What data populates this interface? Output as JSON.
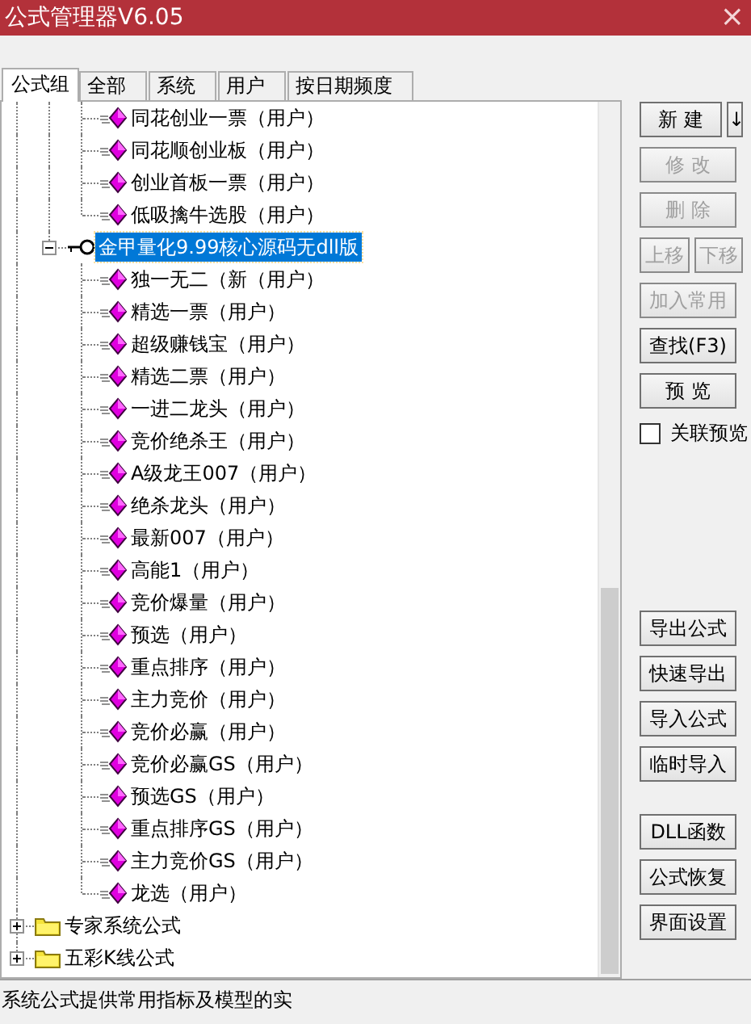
{
  "window": {
    "title": "公式管理器V6.05",
    "close": "×"
  },
  "tabs": [
    {
      "label": "公式组",
      "selected": true
    },
    {
      "label": "全部",
      "selected": false
    },
    {
      "label": "系统",
      "selected": false
    },
    {
      "label": "用户",
      "selected": false
    },
    {
      "label": "按日期频度",
      "selected": false
    }
  ],
  "tree": [
    {
      "children": [
        {
          "children": [
            {
              "kind": "formula",
              "label": "同花创业一票（用户）"
            },
            {
              "kind": "formula",
              "label": "同花顺创业板（用户）"
            },
            {
              "kind": "formula",
              "label": "创业首板一票（用户）"
            },
            {
              "kind": "formula",
              "label": "低吸擒牛选股（用户）"
            }
          ]
        },
        {
          "kind": "group",
          "label": "金甲量化9.99核心源码无dll版",
          "expanded": true,
          "selected": true,
          "children": [
            {
              "kind": "formula",
              "label": "独一无二（新（用户）"
            },
            {
              "kind": "formula",
              "label": "精选一票（用户）"
            },
            {
              "kind": "formula",
              "label": "超级赚钱宝（用户）"
            },
            {
              "kind": "formula",
              "label": "精选二票（用户）"
            },
            {
              "kind": "formula",
              "label": "一进二龙头（用户）"
            },
            {
              "kind": "formula",
              "label": "竞价绝杀王（用户）"
            },
            {
              "kind": "formula",
              "label": "A级龙王007（用户）"
            },
            {
              "kind": "formula",
              "label": "绝杀龙头（用户）"
            },
            {
              "kind": "formula",
              "label": "最新007（用户）"
            },
            {
              "kind": "formula",
              "label": "高能1（用户）"
            },
            {
              "kind": "formula",
              "label": "竞价爆量（用户）"
            },
            {
              "kind": "formula",
              "label": "预选（用户）"
            },
            {
              "kind": "formula",
              "label": "重点排序（用户）"
            },
            {
              "kind": "formula",
              "label": "主力竞价（用户）"
            },
            {
              "kind": "formula",
              "label": "竞价必赢（用户）"
            },
            {
              "kind": "formula",
              "label": "竞价必赢GS（用户）"
            },
            {
              "kind": "formula",
              "label": "预选GS（用户）"
            },
            {
              "kind": "formula",
              "label": "重点排序GS（用户）"
            },
            {
              "kind": "formula",
              "label": "主力竞价GS（用户）"
            },
            {
              "kind": "formula",
              "label": "龙选（用户）"
            }
          ]
        }
      ]
    },
    {
      "kind": "folder",
      "label": "专家系统公式",
      "expanded": false
    },
    {
      "kind": "folder",
      "label": "五彩K线公式",
      "expanded": false
    }
  ],
  "actions": [
    {
      "rows": [
        [
          {
            "label": "新 建",
            "disabled": false
          },
          {
            "label": "↓",
            "disabled": false
          }
        ],
        [
          {
            "label": "修 改",
            "disabled": true
          }
        ],
        [
          {
            "label": "删 除",
            "disabled": true
          }
        ],
        [
          {
            "label": "上移",
            "disabled": true
          },
          {
            "label": "下移",
            "disabled": true
          }
        ],
        [
          {
            "label": "加入常用",
            "disabled": true
          }
        ],
        [
          {
            "label": "查找(F3)",
            "disabled": false
          }
        ],
        [
          {
            "label": "预 览",
            "disabled": false
          }
        ]
      ],
      "checkbox": {
        "label": "关联预览",
        "checked": false
      }
    },
    {
      "rows": [
        [
          {
            "label": "导出公式",
            "disabled": false
          }
        ],
        [
          {
            "label": "快速导出",
            "disabled": false
          }
        ],
        [
          {
            "label": "导入公式",
            "disabled": false
          }
        ],
        [
          {
            "label": "临时导入",
            "disabled": false
          }
        ]
      ]
    },
    {
      "rows": [
        [
          {
            "label": "DLL函数",
            "disabled": false
          }
        ],
        [
          {
            "label": "公式恢复",
            "disabled": false
          }
        ],
        [
          {
            "label": "界面设置",
            "disabled": false
          }
        ]
      ]
    }
  ],
  "status_bar": "系统公式提供常用指标及模型的实"
}
